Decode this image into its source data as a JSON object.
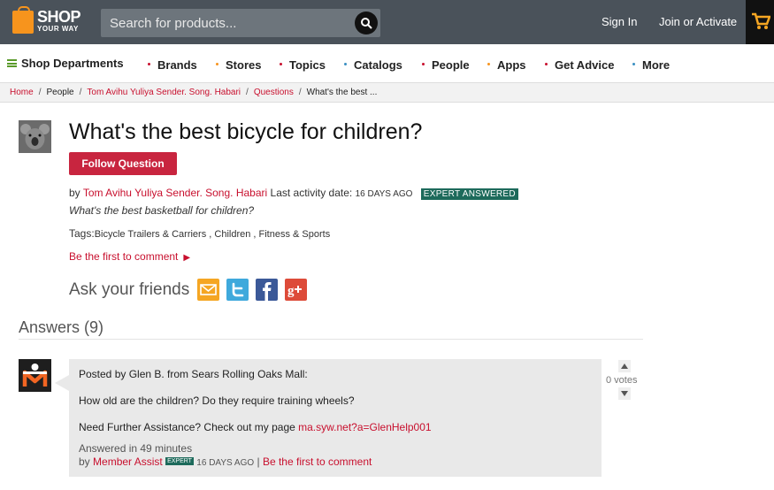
{
  "header": {
    "logo_line1": "SHOP",
    "logo_line2": "YOUR WAY",
    "search_placeholder": "Search for products...",
    "sign_in": "Sign In",
    "join": "Join or Activate"
  },
  "nav": {
    "shop_departments": "Shop Departments",
    "items": [
      {
        "label": "Brands",
        "dot_color": "#c8102e"
      },
      {
        "label": "Stores",
        "dot_color": "#f7941d"
      },
      {
        "label": "Topics",
        "dot_color": "#c8102e"
      },
      {
        "label": "Catalogs",
        "dot_color": "#3a8fc2"
      },
      {
        "label": "People",
        "dot_color": "#c8102e"
      },
      {
        "label": "Apps",
        "dot_color": "#f7941d"
      },
      {
        "label": "Get Advice",
        "dot_color": "#c8102e"
      },
      {
        "label": "More",
        "dot_color": "#3a8fc2"
      }
    ]
  },
  "breadcrumb": {
    "items": [
      "Home",
      "People",
      "Tom Avihu Yuliya Sender. Song. Habari",
      "Questions"
    ],
    "current": "What's the best ...",
    "separator": "/"
  },
  "question": {
    "title": "What's the best bicycle for children?",
    "follow_label": "Follow Question",
    "by_prefix": "by",
    "author": "Tom Avihu Yuliya Sender. Song. Habari",
    "activity_label": "Last activity date:",
    "activity_date": "16 DAYS AGO",
    "badge": "EXPERT ANSWERED",
    "description": "What's the best basketball for children?",
    "tags_label": "Tags:",
    "tags_text": "Bicycle Trailers & Carriers , Children , Fitness & Sports",
    "first_comment": "Be the first to comment",
    "first_comment_arrow": "▶",
    "ask_friends": "Ask your friends",
    "share_icons": [
      "email-icon",
      "twitter-icon",
      "facebook-icon",
      "google-plus-icon"
    ]
  },
  "answers": {
    "heading": "Answers (9)",
    "items": [
      {
        "posted_by": "Posted by Glen B. from Sears Rolling Oaks Mall:",
        "body": "How old are the children? Do they require training wheels?",
        "assist_prefix": "Need Further Assistance? Check out my page",
        "assist_link": "ma.syw.net?a=GlenHelp001",
        "answered_in": "Answered in 49 minutes",
        "by_prefix": "by",
        "by_author": "Member Assist",
        "expert_badge": "EXPERT",
        "date": "16 DAYS AGO",
        "separator": "|",
        "comment_link": "Be the first to comment",
        "votes": "0 votes"
      }
    ]
  },
  "colors": {
    "topbar": "#4a525a",
    "accent_red": "#c8102e",
    "expert_green": "#1d6a5b",
    "logo_orange": "#f7941d"
  }
}
